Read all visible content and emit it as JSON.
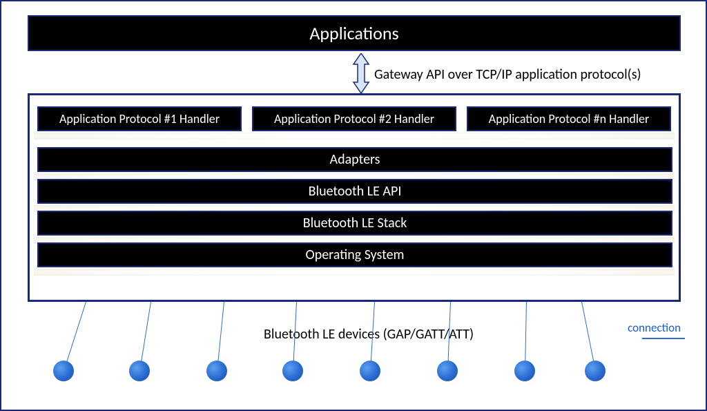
{
  "top_block": {
    "label": "Applications"
  },
  "gateway_api_label": "Gateway API over TCP/IP application protocol(s)",
  "gateway_box": {
    "handlers": [
      {
        "label": "Application Protocol #1 Handler"
      },
      {
        "label": "Application Protocol #2 Handler"
      },
      {
        "label": "Application Protocol #n Handler"
      }
    ],
    "layers": [
      {
        "label": "Adapters"
      },
      {
        "label": "Bluetooth LE  API"
      },
      {
        "label": "Bluetooth LE Stack"
      },
      {
        "label": "Operating System"
      }
    ]
  },
  "devices_label": "Bluetooth LE devices (GAP/GATT/ATT)",
  "legend": {
    "label": "connection"
  },
  "device_count": 8
}
